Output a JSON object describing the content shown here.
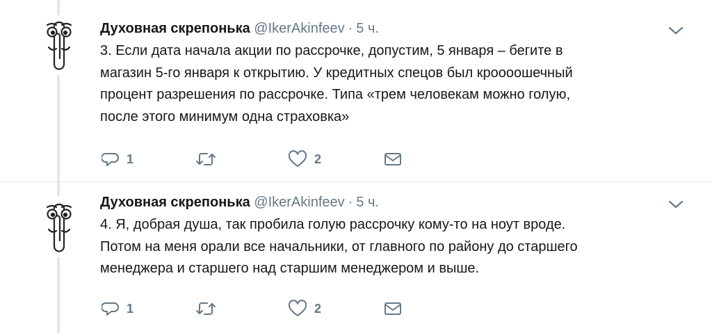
{
  "tweets": [
    {
      "author_name": "Духовная скрепонька",
      "handle": "@IkerAkinfeev",
      "separator": "·",
      "time": "5 ч.",
      "text": "3. Если дата начала акции по рассрочке, допустим, 5 января – бегите в\nмагазин 5-го января к открытию. У кредитных спецов был кроооошечный\nпроцент разрешения по рассрочке. Типа «трем человекам можно голую,\nпосле этого минимум одна страховка»",
      "reply_count": "1",
      "retweet_count": "",
      "like_count": "2",
      "icons": {
        "reply": "reply-icon",
        "retweet": "retweet-icon",
        "like": "heart-icon",
        "dm": "envelope-icon",
        "menu": "chevron-down-icon"
      }
    },
    {
      "author_name": "Духовная скрепонька",
      "handle": "@IkerAkinfeev",
      "separator": "·",
      "time": "5 ч.",
      "text": "4. Я, добрая душа, так пробила голую рассрочку кому-то на ноут вроде.\nПотом на меня орали все начальники, от главного по району до старшего\nменеджера и старшего над старшим менеджером и выше.",
      "reply_count": "1",
      "retweet_count": "",
      "like_count": "2",
      "icons": {
        "reply": "reply-icon",
        "retweet": "retweet-icon",
        "like": "heart-icon",
        "dm": "envelope-icon",
        "menu": "chevron-down-icon"
      }
    }
  ],
  "colors": {
    "text": "#14171a",
    "muted": "#657786",
    "thread_line": "#e1e8ed",
    "divider": "#e6ecf0"
  }
}
